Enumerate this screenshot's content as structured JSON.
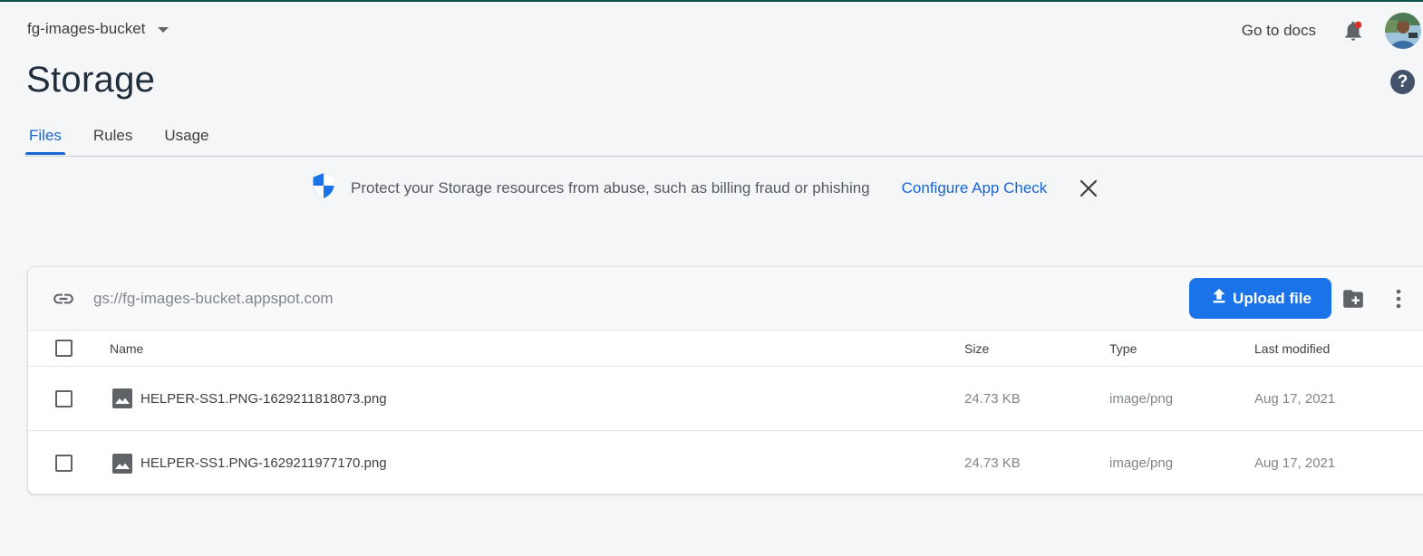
{
  "header": {
    "project_name": "fg-images-bucket",
    "docs_link": "Go to docs",
    "page_title": "Storage",
    "help_label": "?"
  },
  "tabs": [
    {
      "label": "Files",
      "active": true
    },
    {
      "label": "Rules",
      "active": false
    },
    {
      "label": "Usage",
      "active": false
    }
  ],
  "banner": {
    "text": "Protect your Storage resources from abuse, such as billing fraud or phishing",
    "link": "Configure App Check"
  },
  "bucket": {
    "path": "gs://fg-images-bucket.appspot.com",
    "upload_label": "Upload file"
  },
  "table": {
    "columns": [
      "Name",
      "Size",
      "Type",
      "Last modified"
    ],
    "rows": [
      {
        "name": "HELPER-SS1.PNG-1629211818073.png",
        "size": "24.73 KB",
        "type": "image/png",
        "modified": "Aug 17, 2021"
      },
      {
        "name": "HELPER-SS1.PNG-1629211977170.png",
        "size": "24.73 KB",
        "type": "image/png",
        "modified": "Aug 17, 2021"
      }
    ]
  },
  "colors": {
    "accent": "#1a73e8",
    "tab_active": "#1a66d1",
    "background": "#f5f6f8",
    "notification_dot": "#d93025"
  },
  "icons": [
    "chevron-down-icon",
    "bell-icon",
    "help-icon",
    "shield-icon",
    "close-icon",
    "link-icon",
    "upload-icon",
    "folder-add-icon",
    "more-vert-icon",
    "image-file-icon"
  ]
}
